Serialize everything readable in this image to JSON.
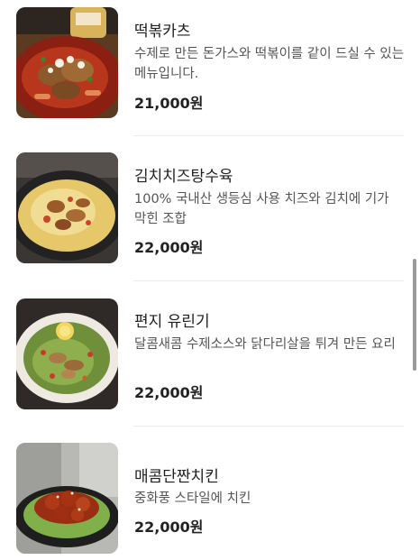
{
  "menu": {
    "items": [
      {
        "name": "떡볶카츠",
        "description": "수제로 만든 돈가스와 떡볶이를 같이 드실 수 있는 메뉴입니다.",
        "price": "21,000원"
      },
      {
        "name": "김치치즈탕수육",
        "description": "100% 국내산 생등심 사용 치즈와 김치에 기가 막힌 조합",
        "price": "22,000원"
      },
      {
        "name": "편지 유린기",
        "description": "달콤새콤 수제소스와 닭다리살을 튀겨 만든 요리",
        "price": "22,000원"
      },
      {
        "name": "매콤단짠치킨",
        "description": "중화풍 스타일에 치킨",
        "price": "22,000원"
      }
    ]
  }
}
